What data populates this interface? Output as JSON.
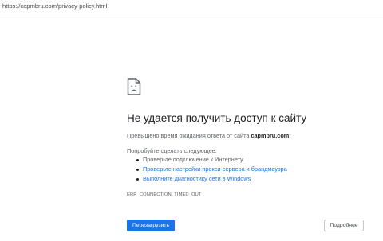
{
  "browser": {
    "url": "https://capmbru.com/privacy-policy.html"
  },
  "error_page": {
    "icon": "sad-page-icon",
    "title": "Не удается получить доступ к сайту",
    "description_prefix": "Превышено время ожидания ответа от сайта ",
    "description_host": "capmbru.com",
    "description_suffix": ".",
    "try_label": "Попробуйте сделать следующее:",
    "suggestions": [
      {
        "text": "Проверьте подключение к Интернету.",
        "is_link": false
      },
      {
        "text": "Проверьте настройки прокси-сервера и брандмауэра",
        "is_link": true
      },
      {
        "text": "Выполните диагностику сети в Windows",
        "is_link": true
      }
    ],
    "error_code": "ERR_CONNECTION_TIMED_OUT",
    "reload_label": "Перезагрузить",
    "details_label": "Подробнее"
  },
  "colors": {
    "accent": "#1a73e8",
    "text_primary": "#202124",
    "text_secondary": "#5f6368"
  }
}
